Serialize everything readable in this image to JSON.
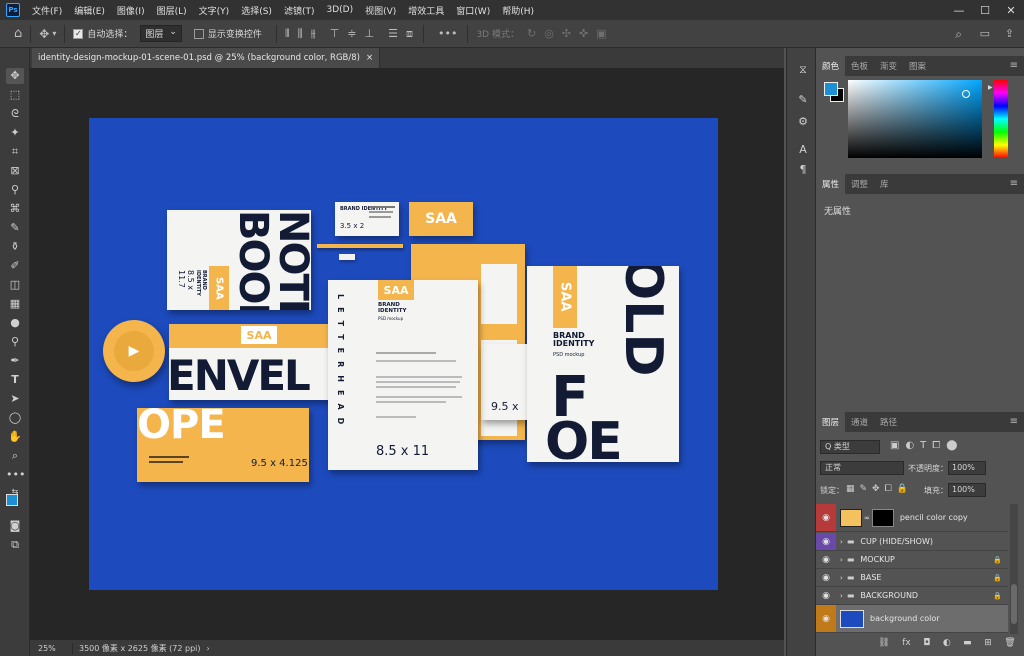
{
  "app": {
    "logo": "Ps"
  },
  "menu": [
    "文件(F)",
    "编辑(E)",
    "图像(I)",
    "图层(L)",
    "文字(Y)",
    "选择(S)",
    "滤镜(T)",
    "3D(D)",
    "视图(V)",
    "增效工具",
    "窗口(W)",
    "帮助(H)"
  ],
  "window_controls": {
    "minimize": "—",
    "maximize": "☐",
    "close": "✕"
  },
  "options": {
    "auto_select_label": "自动选择：",
    "auto_select_target": "图层",
    "show_transform_label": "显示变换控件",
    "mode3d_label": "3D 模式：",
    "more": "•••"
  },
  "document": {
    "tab_title": "identity-design-mockup-01-scene-01.psd @ 25% (background color, RGB/8)",
    "close": "×"
  },
  "status": {
    "zoom": "25%",
    "size": "3500 像素 x 2625 像素 (72 ppi)",
    "arrow": "›"
  },
  "color_panel": {
    "tabs": [
      "颜色",
      "色板",
      "渐变",
      "图案"
    ],
    "foreground": "#1e8fd4",
    "background": "#000000"
  },
  "properties_panel": {
    "tabs": [
      "属性",
      "调整",
      "库"
    ],
    "content": "无属性"
  },
  "layers_panel": {
    "tabs": [
      "图层",
      "通道",
      "路径"
    ],
    "filter_label": "Q 类型",
    "blend_mode": "正常",
    "opacity_label": "不透明度：",
    "opacity": "100%",
    "lock_label": "锁定：",
    "fill_label": "填充：",
    "fill": "100%",
    "layers": [
      {
        "name": "pencil color copy",
        "eye_color": "#b63a3a",
        "kind": "fill"
      },
      {
        "name": "CUP (HIDE/SHOW)",
        "eye_color": "#6a4aa8",
        "kind": "group"
      },
      {
        "name": "MOCKUP",
        "eye_color": "",
        "kind": "group",
        "locked": true
      },
      {
        "name": "BASE",
        "eye_color": "",
        "kind": "group",
        "locked": true
      },
      {
        "name": "BACKGROUND",
        "eye_color": "",
        "kind": "group",
        "locked": true
      },
      {
        "name": "background color",
        "eye_color": "#c07a1a",
        "kind": "image",
        "selected": true
      }
    ]
  },
  "artwork": {
    "canvas_color": "#1d4bbd",
    "notebook": {
      "big": "NOTE BOOK",
      "brand": "SAA",
      "size": "8.5 x 11.7",
      "label": "BRAND IDENTITY"
    },
    "card": {
      "title": "BRAND IDENTITY",
      "size": "3.5 x 2"
    },
    "card_orange": {
      "brand": "SAA"
    },
    "cup": {
      "play": "▶"
    },
    "envelope": {
      "brand": "SAA",
      "word1": "ENVEL",
      "word2": "OPE",
      "size": "9.5 x 4.125"
    },
    "letterhead": {
      "brand": "SAA",
      "title": "BRAND IDENTITY",
      "sub": "PSD mockup",
      "vertical": "LETTERHEAD",
      "size": "8.5 x 11"
    },
    "folder_back": {
      "size": "9.5 x"
    },
    "folder": {
      "brand": "SAA",
      "title": "BRAND IDENTITY",
      "sub": "PSD mockup",
      "big1": "OLD",
      "big2": "F",
      "big3": "OE"
    }
  }
}
